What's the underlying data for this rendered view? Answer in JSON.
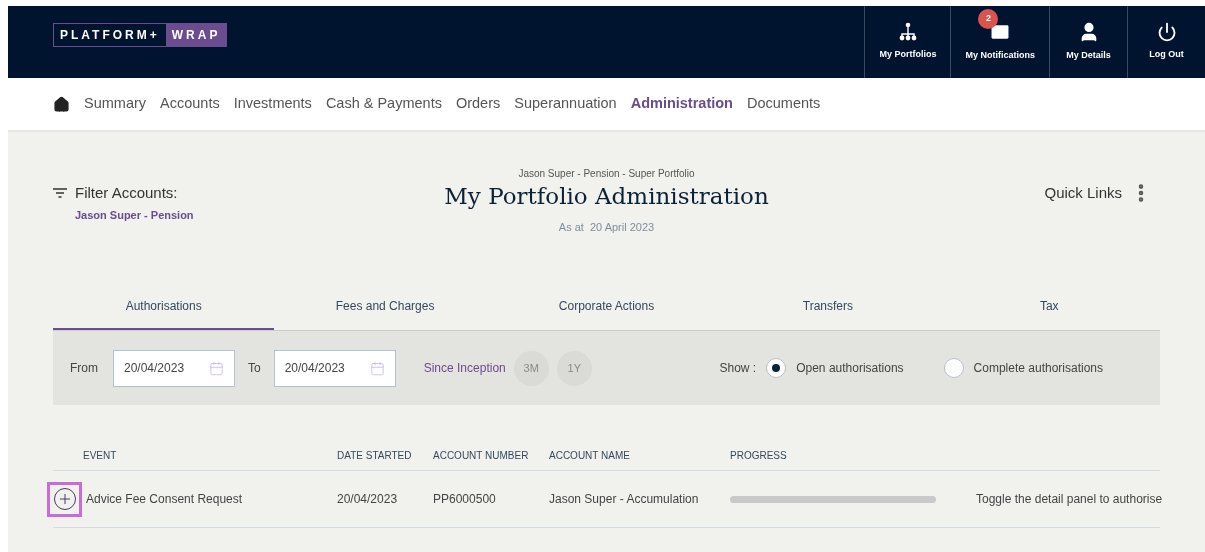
{
  "logo": {
    "left": "PLATFORM+",
    "right": "WRAP"
  },
  "header_actions": [
    {
      "kind": "portfolios",
      "label": "My Portfolios"
    },
    {
      "kind": "notifications",
      "label": "My Notifications",
      "badge": "2"
    },
    {
      "kind": "details",
      "label": "My Details"
    },
    {
      "kind": "logout",
      "label": "Log Out"
    }
  ],
  "nav": [
    {
      "label": "Summary",
      "selected": false
    },
    {
      "label": "Accounts",
      "selected": false
    },
    {
      "label": "Investments",
      "selected": false
    },
    {
      "label": "Cash & Payments",
      "selected": false
    },
    {
      "label": "Orders",
      "selected": false
    },
    {
      "label": "Superannuation",
      "selected": false
    },
    {
      "label": "Administration",
      "selected": true
    },
    {
      "label": "Documents",
      "selected": false
    }
  ],
  "filter": {
    "label": "Filter Accounts:",
    "value": "Jason Super - Pension"
  },
  "page": {
    "subtitle": "Jason Super - Pension - Super Portfolio",
    "title": "My Portfolio Administration",
    "as_at": "As at  20 April 2023"
  },
  "quick_links": "Quick Links",
  "tabs": [
    {
      "label": "Authorisations",
      "selected": true
    },
    {
      "label": "Fees and Charges",
      "selected": false
    },
    {
      "label": "Corporate Actions",
      "selected": false
    },
    {
      "label": "Transfers",
      "selected": false
    },
    {
      "label": "Tax",
      "selected": false
    }
  ],
  "date_filter": {
    "from_label": "From",
    "from_value": "20/04/2023",
    "to_label": "To",
    "to_value": "20/04/2023",
    "since": "Since Inception",
    "periods": [
      "3M",
      "1Y"
    ]
  },
  "show": {
    "label": "Show :",
    "options": [
      {
        "label": "Open authorisations",
        "selected": true
      },
      {
        "label": "Complete authorisations",
        "selected": false
      }
    ]
  },
  "table": {
    "columns": [
      "EVENT",
      "DATE STARTED",
      "ACCOUNT NUMBER",
      "ACCOUNT NAME",
      "PROGRESS"
    ],
    "rows": [
      {
        "event": "Advice Fee Consent Request",
        "date_started": "20/04/2023",
        "account_number": "PP6000500",
        "account_name": "Jason Super - Accumulation",
        "level": 0,
        "status": "Toggle the detail panel to authorise",
        "expanded": false
      }
    ]
  }
}
